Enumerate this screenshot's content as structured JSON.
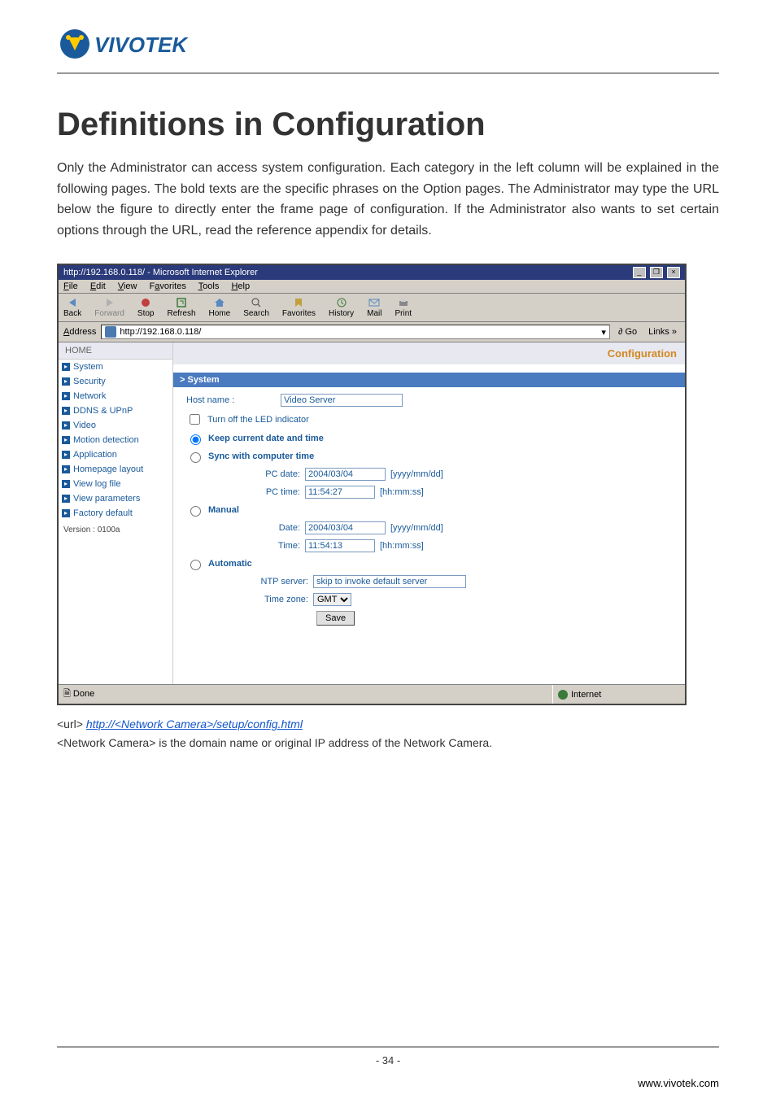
{
  "doc": {
    "heading": "Definitions in Configuration",
    "intro": "Only the Administrator can access system configuration. Each category in the left column will be explained in the following pages. The bold texts are the specific phrases on the Option pages. The Administrator may type the URL below the figure to directly enter the frame page of configuration. If the Administrator also wants to set certain options through the URL, read the reference appendix for details.",
    "url_prefix": "<url> ",
    "url_link": "http://<Network Camera>/setup/config.html",
    "url_note": "<Network Camera> is the domain name or original IP address of the Network Camera.",
    "page_num": "- 34 -",
    "site": "www.vivotek.com"
  },
  "browser": {
    "title": "http://192.168.0.118/ - Microsoft Internet Explorer",
    "menu": [
      "File",
      "Edit",
      "View",
      "Favorites",
      "Tools",
      "Help"
    ],
    "toolbar": [
      "Back",
      "Forward",
      "Stop",
      "Refresh",
      "Home",
      "Search",
      "Favorites",
      "History",
      "Mail",
      "Print"
    ],
    "address_label": "Address",
    "address_value": "http://192.168.0.118/",
    "go_label": "Go",
    "links_label": "Links »",
    "status_left": "Done",
    "status_right": "Internet"
  },
  "config": {
    "banner": "Configuration",
    "home": "HOME",
    "side_items": [
      "System",
      "Security",
      "Network",
      "DDNS & UPnP",
      "Video",
      "Motion detection",
      "Application",
      "Homepage layout",
      "View log file",
      "View parameters",
      "Factory default"
    ],
    "version": "Version : 0100a",
    "panel_title": "> System",
    "host_label": "Host name :",
    "host_value": "Video Server",
    "led_label": "Turn off the LED indicator",
    "radio_keep": "Keep current date and time",
    "radio_sync": "Sync with computer time",
    "pc_date_label": "PC date:",
    "pc_date_value": "2004/03/04",
    "pc_date_hint": "[yyyy/mm/dd]",
    "pc_time_label": "PC time:",
    "pc_time_value": "11:54:27",
    "pc_time_hint": "[hh:mm:ss]",
    "radio_manual": "Manual",
    "m_date_label": "Date:",
    "m_date_value": "2004/03/04",
    "m_date_hint": "[yyyy/mm/dd]",
    "m_time_label": "Time:",
    "m_time_value": "11:54:13",
    "m_time_hint": "[hh:mm:ss]",
    "radio_auto": "Automatic",
    "ntp_label": "NTP server:",
    "ntp_value": "skip to invoke default server",
    "tz_label": "Time zone:",
    "tz_value": "GMT",
    "save": "Save"
  }
}
